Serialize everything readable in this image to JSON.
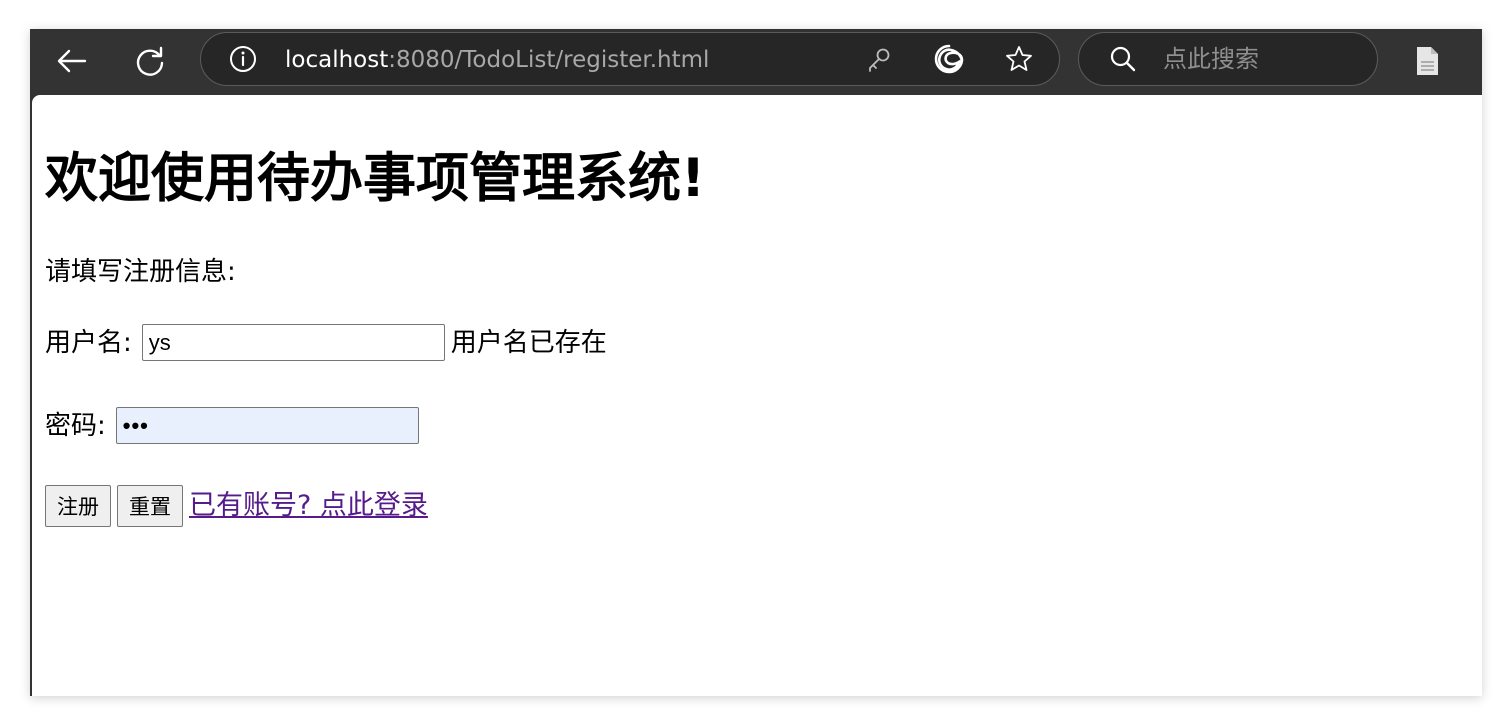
{
  "browser": {
    "url_host": "localhost",
    "url_rest": ":8080/TodoList/register.html",
    "search_placeholder": "点此搜索"
  },
  "page": {
    "heading": "欢迎使用待办事项管理系统!",
    "intro": "请填写注册信息:",
    "username_label": "用户名:",
    "username_value": "ys",
    "username_error": "用户名已存在",
    "password_label": "密码:",
    "password_value": "•••",
    "register_button": "注册",
    "reset_button": "重置",
    "login_link": "已有账号? 点此登录"
  },
  "colors": {
    "toolbar_bg": "#333333",
    "link_visited": "#551a8b",
    "autofill_bg": "#e8f0fe"
  },
  "icons": [
    "back-arrow-icon",
    "refresh-icon",
    "info-icon",
    "key-icon",
    "edge-icon",
    "star-icon",
    "search-icon",
    "page-icon"
  ]
}
